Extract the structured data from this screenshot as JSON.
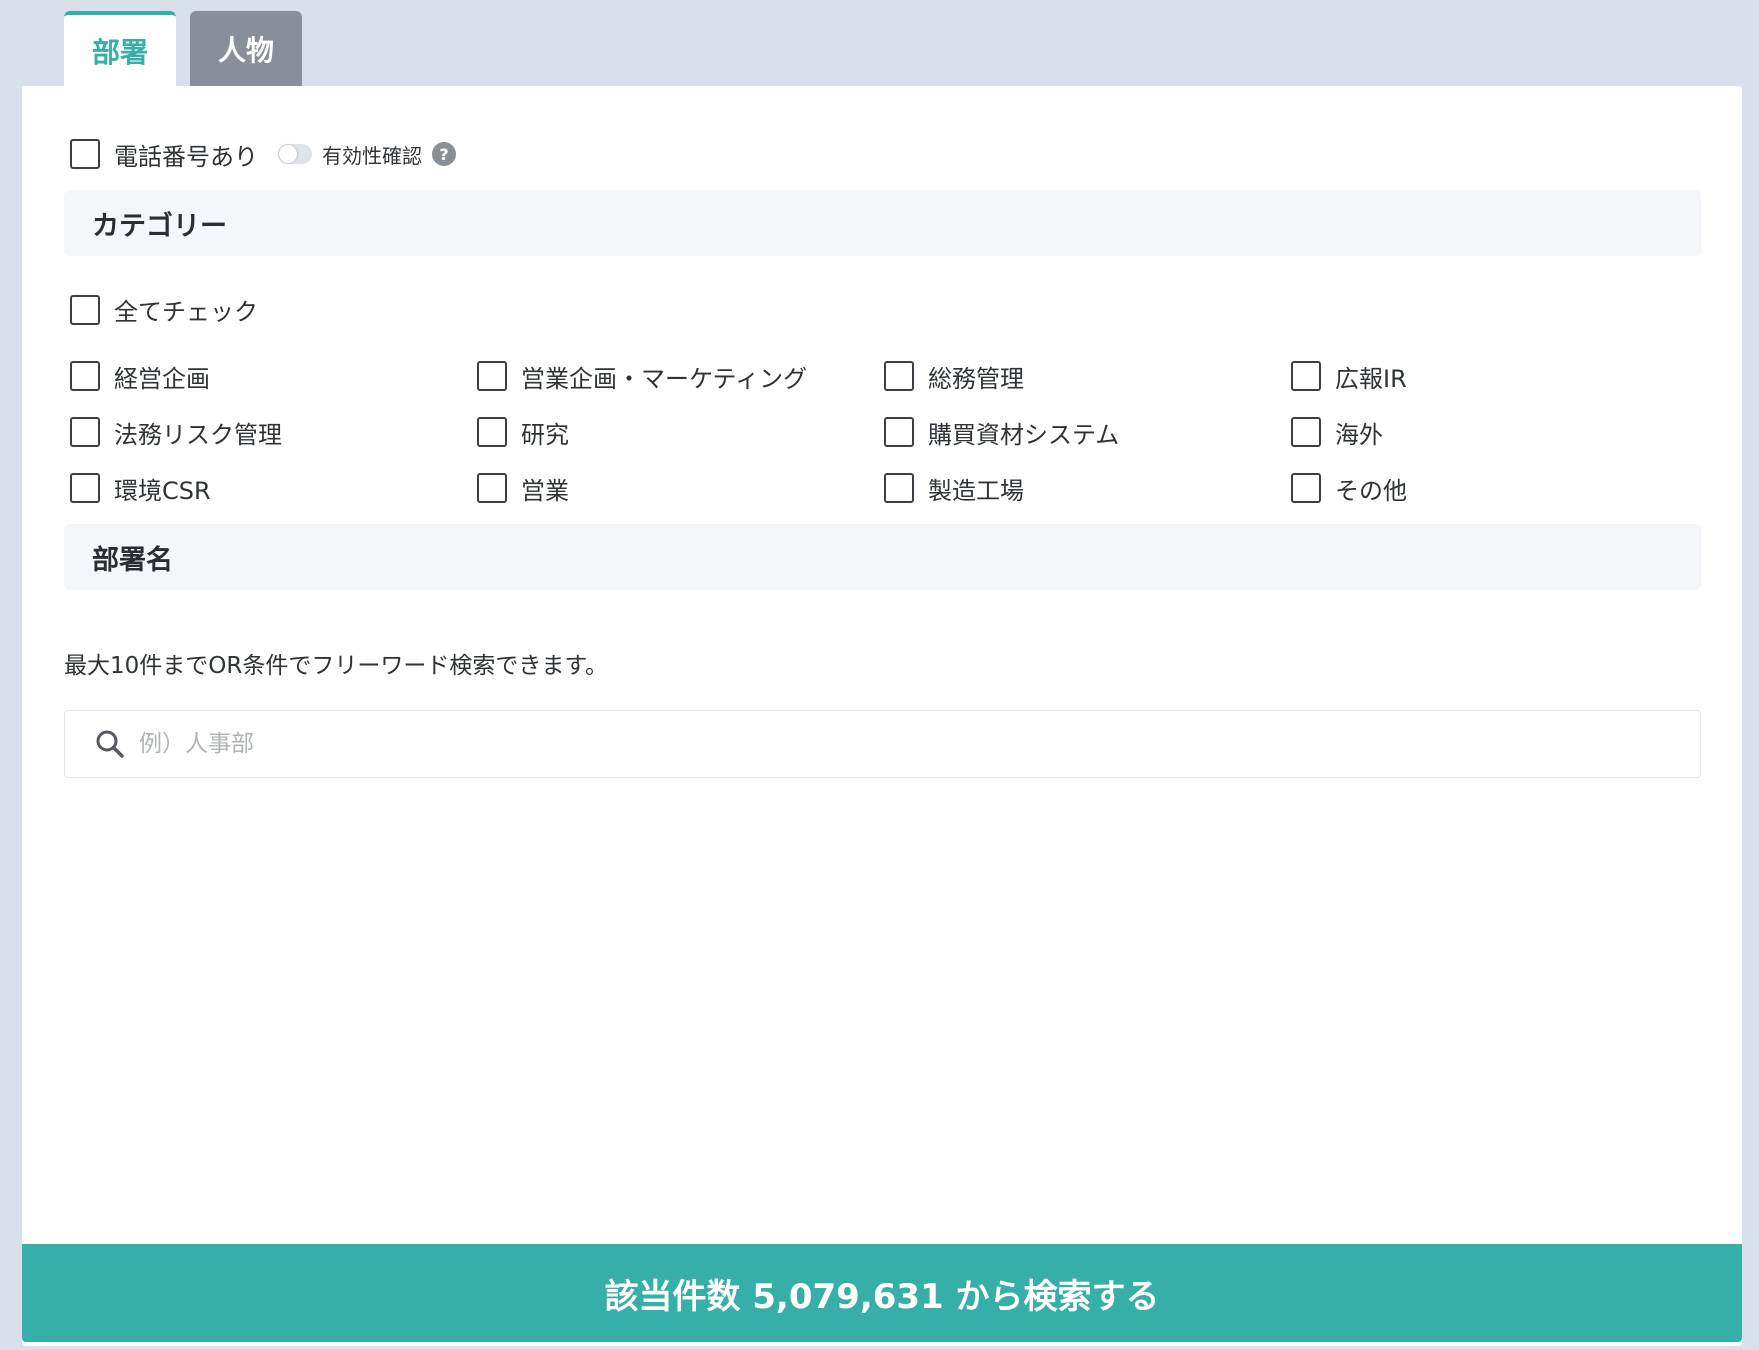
{
  "tabs": [
    {
      "label": "部署",
      "active": true
    },
    {
      "label": "人物",
      "active": false
    }
  ],
  "options": {
    "phone_label": "電話番号あり",
    "validity_label": "有効性確認",
    "help_glyph": "?"
  },
  "category": {
    "title": "カテゴリー",
    "check_all_label": "全てチェック",
    "items": [
      "経営企画",
      "営業企画・マーケティング",
      "総務管理",
      "広報IR",
      "法務リスク管理",
      "研究",
      "購買資材システム",
      "海外",
      "環境CSR",
      "営業",
      "製造工場",
      "その他"
    ]
  },
  "department": {
    "title": "部署名",
    "hint": "最大10件までOR条件でフリーワード検索できます。",
    "search_placeholder": "例）人事部"
  },
  "search_button": {
    "label": "該当件数 5,079,631 から検索する"
  },
  "colors": {
    "accent": "#36afa8",
    "background": "#d9dfeb",
    "inactive_tab": "#8a8e98"
  }
}
